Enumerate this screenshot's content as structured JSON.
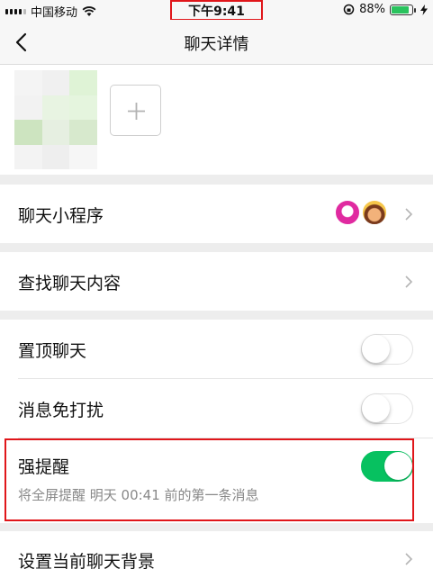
{
  "status_bar": {
    "carrier": "中国移动",
    "time": "下午9:41",
    "battery_percent": "88%",
    "battery_level": 0.88,
    "highlight_color": "#e0161a"
  },
  "nav": {
    "title": "聊天详情",
    "back_icon": "chevron-left-icon"
  },
  "members": {
    "add_icon": "plus-icon"
  },
  "mini_programs": {
    "label": "聊天小程序",
    "app_icons": [
      "mini-app-icon-1",
      "mini-app-icon-2"
    ]
  },
  "search_history": {
    "label": "查找聊天内容"
  },
  "pin_chat": {
    "label": "置顶聊天",
    "enabled": false
  },
  "mute": {
    "label": "消息免打扰",
    "enabled": false
  },
  "strong_reminder": {
    "label": "强提醒",
    "sublabel": "将全屏提醒 明天 00:41 前的第一条消息",
    "enabled": true
  },
  "background": {
    "label": "设置当前聊天背景"
  },
  "colors": {
    "toggle_on": "#07c160",
    "page_bg": "#ededed",
    "highlight": "#e0161a"
  }
}
